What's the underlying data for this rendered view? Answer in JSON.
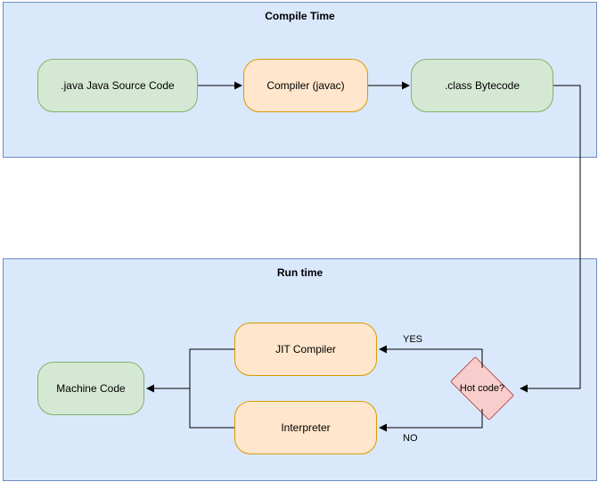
{
  "sections": {
    "compile": {
      "title": "Compile Time"
    },
    "runtime": {
      "title": "Run time"
    }
  },
  "nodes": {
    "source": {
      "label": ".java Java Source Code"
    },
    "compiler": {
      "label": "Compiler (javac)"
    },
    "bytecode": {
      "label": ".class Bytecode"
    },
    "jit": {
      "label": "JIT Compiler"
    },
    "interpreter": {
      "label": "Interpreter"
    },
    "machine": {
      "label": "Machine Code"
    },
    "hotcode": {
      "label": "Hot code?"
    }
  },
  "edges": {
    "yes": {
      "label": "YES"
    },
    "no": {
      "label": "NO"
    }
  }
}
